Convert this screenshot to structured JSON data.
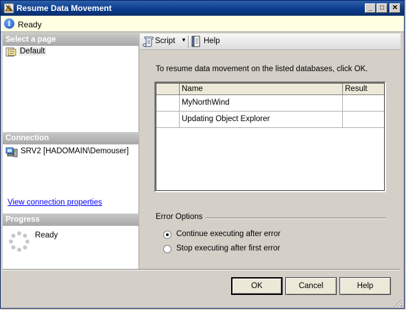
{
  "window": {
    "title": "Resume Data Movement"
  },
  "status": {
    "text": "Ready",
    "icon": "info-icon"
  },
  "left": {
    "select_page_header": "Select a page",
    "pages": [
      {
        "label": "Default",
        "icon": "page-icon"
      }
    ],
    "connection_header": "Connection",
    "connection_text": "SRV2 [HADOMAIN\\Demouser]",
    "connection_link": "View connection properties",
    "progress_header": "Progress",
    "progress_text": "Ready"
  },
  "toolbar": {
    "script_label": "Script",
    "help_label": "Help"
  },
  "main": {
    "instructions": "To resume data movement on the listed databases, click OK.",
    "grid": {
      "columns": [
        "",
        "Name",
        "Result"
      ],
      "rows": [
        {
          "name": "MyNorthWind",
          "result": ""
        },
        {
          "name": "Updating Object Explorer",
          "result": ""
        }
      ]
    },
    "error_options": {
      "title": "Error Options",
      "options": [
        {
          "label": "Continue executing after error",
          "selected": true
        },
        {
          "label": "Stop executing after first error",
          "selected": false
        }
      ]
    }
  },
  "buttons": {
    "ok": "OK",
    "cancel": "Cancel",
    "help": "Help"
  }
}
